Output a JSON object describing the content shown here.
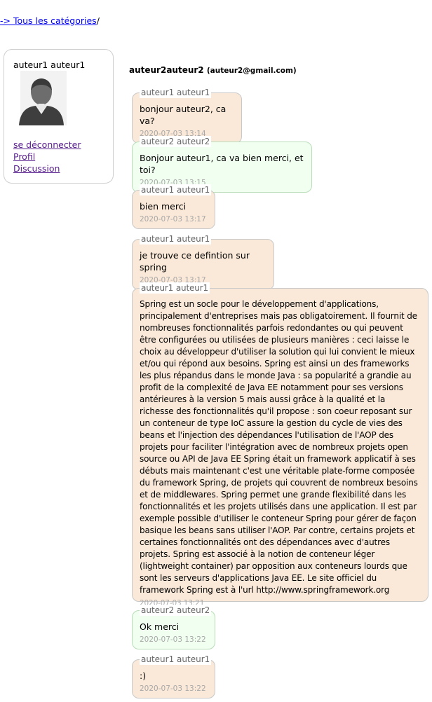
{
  "breadcrumb": {
    "link": "-> Tous les catégories",
    "sep": "/"
  },
  "user_panel": {
    "name": "auteur1 auteur1",
    "avatar_icon": "user-silhouette-icon",
    "links": [
      "se déconnecter",
      "Profil",
      "Discussion"
    ]
  },
  "conversation": {
    "title": "auteur2auteur2",
    "email": "(auteur2@gmail.com)",
    "messages": [
      {
        "sender": "auteur1 auteur1",
        "text": "bonjour auteur2, ca va?",
        "time": "2020-07-03 13:14",
        "mine": true
      },
      {
        "sender": "auteur2 auteur2",
        "text": "Bonjour auteur1, ca va bien merci, et toi?",
        "time": "2020-07-03 13:15",
        "mine": false
      },
      {
        "sender": "auteur1 auteur1",
        "text": "bien merci",
        "time": "2020-07-03 13:17",
        "mine": true
      },
      {
        "sender": "auteur1 auteur1",
        "text": "je trouve ce defintion sur spring",
        "time": "2020-07-03 13:17",
        "mine": true
      },
      {
        "sender": "auteur1 auteur1",
        "text": "Spring est un socle pour le développement d'applications, principalement d'entreprises mais pas obligatoirement. Il fournit de nombreuses fonctionnalités parfois redondantes ou qui peuvent être configurées ou utilisées de plusieurs manières : ceci laisse le choix au développeur d'utiliser la solution qui lui convient le mieux et/ou qui répond aux besoins. Spring est ainsi un des frameworks les plus répandus dans le monde Java : sa popularité a grandie au profit de la complexité de Java EE notamment pour ses versions antérieures à la version 5 mais aussi grâce à la qualité et la richesse des fonctionnalités qu'il propose : son coeur reposant sur un conteneur de type IoC assure la gestion du cycle de vies des beans et l'injection des dépendances l'utilisation de l'AOP des projets pour faciliter l'intégration avec de nombreux projets open source ou API de Java EE Spring était un framework applicatif à ses débuts mais maintenant c'est une véritable plate-forme composée du framework Spring, de projets qui couvrent de nombreux besoins et de middlewares. Spring permet une grande flexibilité dans les fonctionnalités et les projets utilisés dans une application. Il est par exemple possible d'utiliser le conteneur Spring pour gérer de façon basique les beans sans utiliser l'AOP. Par contre, certains projets et certaines fonctionnalités ont des dépendances avec d'autres projets. Spring est associé à la notion de conteneur léger (lightweight container) par opposition aux conteneurs lourds que sont les serveurs d'applications Java EE. Le site officiel du framework Spring est à l'url http://www.springframework.org",
        "time": "2020-07-03 13:21",
        "mine": true
      },
      {
        "sender": "auteur2 auteur2",
        "text": "Ok merci",
        "time": "2020-07-03 13:22",
        "mine": false
      },
      {
        "sender": "auteur1 auteur1",
        "text": ":)",
        "time": "2020-07-03 13:22",
        "mine": true
      }
    ]
  }
}
